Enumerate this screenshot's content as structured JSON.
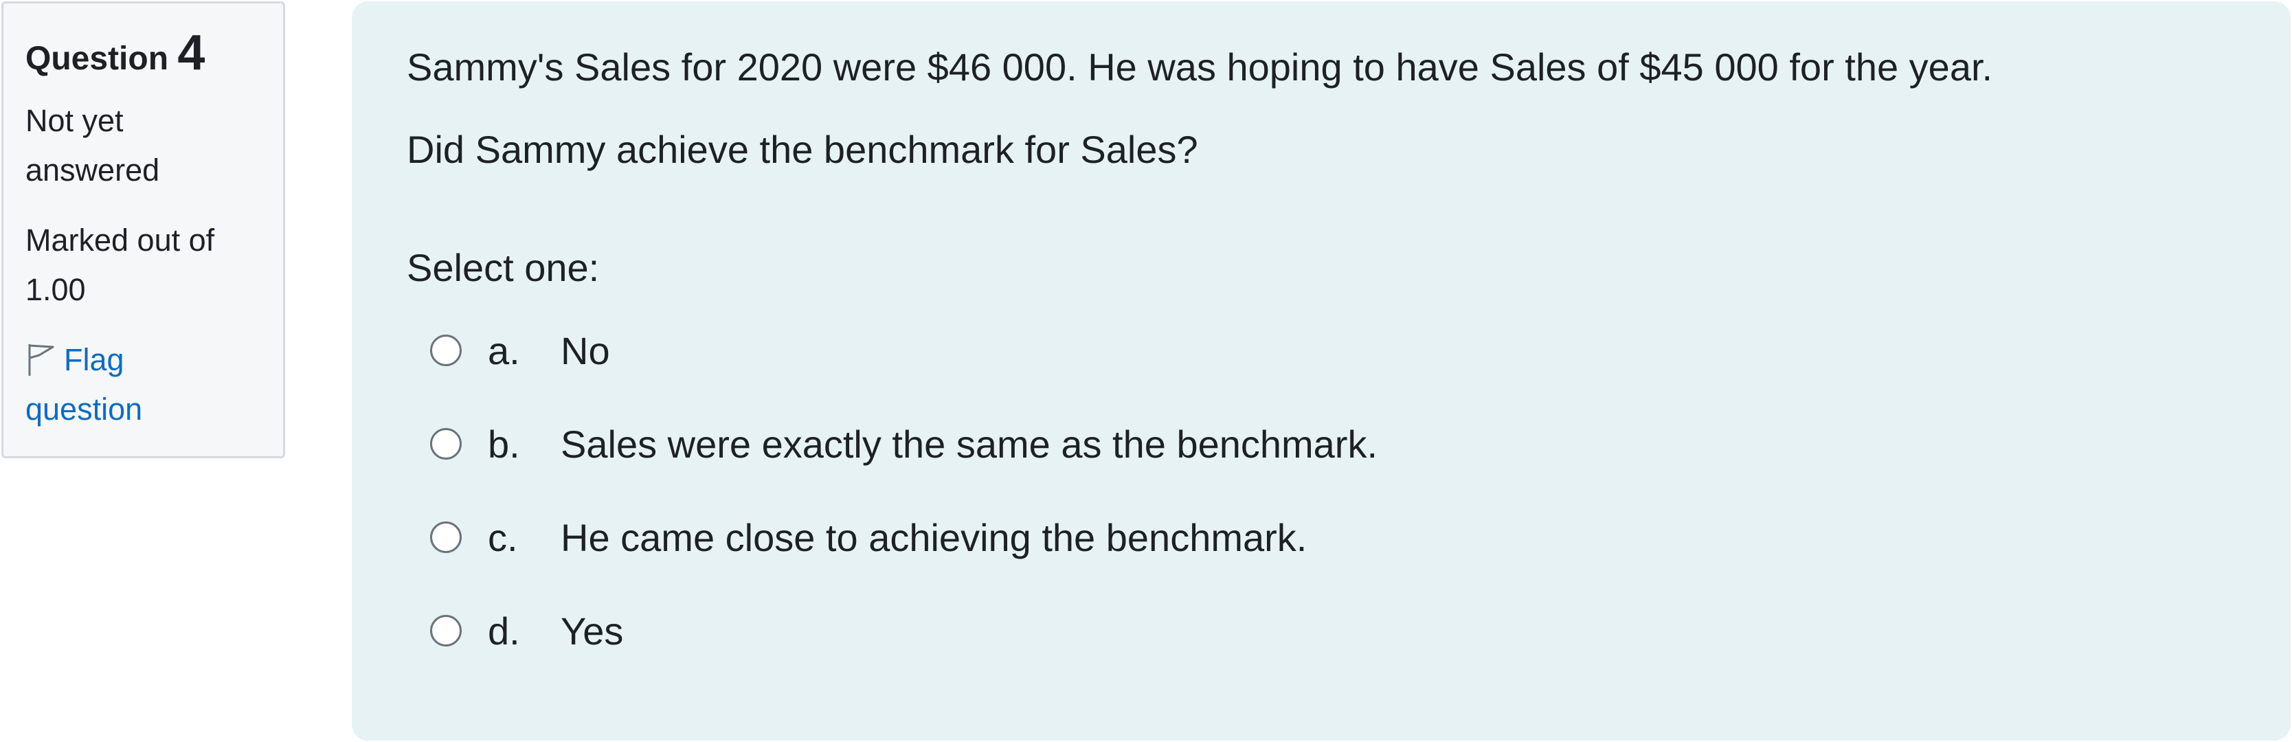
{
  "info": {
    "question_label": "Question",
    "question_number": "4",
    "state": "Not yet answered",
    "grade": "Marked out of 1.00",
    "flag_label": "Flag question"
  },
  "question": {
    "text_1": "Sammy's Sales for 2020 were $46 000. He was hoping to have Sales of $45 000 for the year.",
    "text_2": "Did Sammy achieve the benchmark for Sales?",
    "prompt": "Select one:",
    "options": [
      {
        "letter": "a.",
        "text": "No"
      },
      {
        "letter": "b.",
        "text": "Sales were exactly the same as the benchmark."
      },
      {
        "letter": "c.",
        "text": "He came close to achieving the benchmark."
      },
      {
        "letter": "d.",
        "text": "Yes"
      }
    ]
  }
}
